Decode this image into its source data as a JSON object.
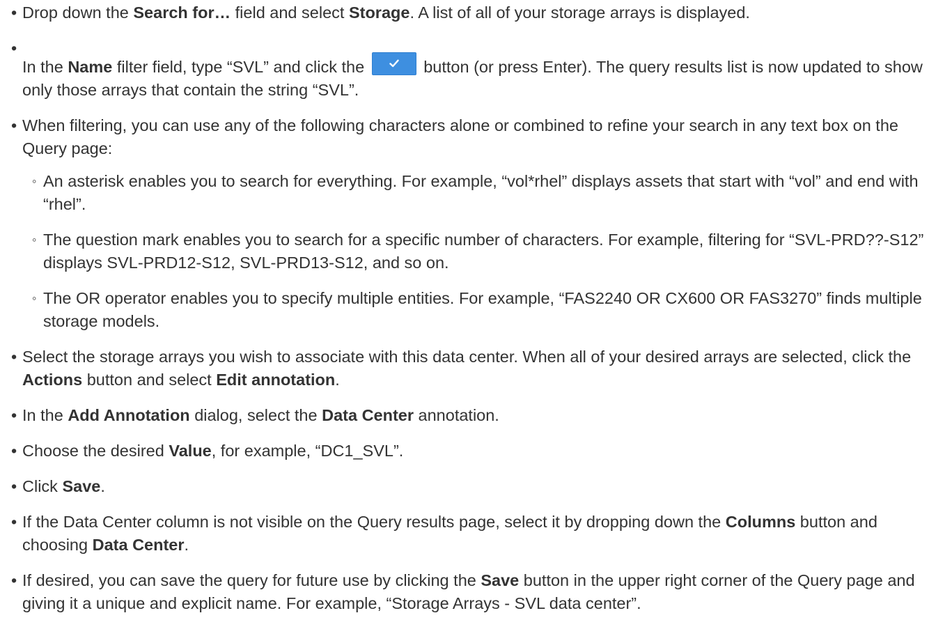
{
  "steps": [
    {
      "parts": [
        {
          "t": "Drop down the "
        },
        {
          "t": "Search for…",
          "b": true
        },
        {
          "t": " field and select "
        },
        {
          "t": "Storage",
          "b": true
        },
        {
          "t": ". A list of all of your storage arrays is displayed."
        }
      ]
    },
    {
      "parts_before": [
        {
          "t": "In the "
        },
        {
          "t": "Name",
          "b": true
        },
        {
          "t": " filter field, type “SVL” and click the "
        }
      ],
      "button_icon": "checkmark-icon",
      "parts_after": [
        {
          "t": " button (or press Enter). The query results list is now updated to show only those arrays that contain the string “SVL”."
        }
      ]
    },
    {
      "parts": [
        {
          "t": "When filtering, you can use any of the following characters alone or combined to refine your search in any text box on the Query page:"
        }
      ],
      "subitems": [
        "An asterisk enables you to search for everything. For example, “vol*rhel” displays assets that start with “vol” and end with “rhel”.",
        "The question mark enables you to search for a specific number of characters. For example, filtering for “SVL-PRD??-S12” displays SVL-PRD12-S12, SVL-PRD13-S12, and so on.",
        "The OR operator enables you to specify multiple entities. For example, “FAS2240 OR CX600 OR FAS3270” finds multiple storage models."
      ]
    },
    {
      "parts": [
        {
          "t": "Select the storage arrays you wish to associate with this data center. When all of your desired arrays are selected, click the "
        },
        {
          "t": "Actions",
          "b": true
        },
        {
          "t": " button and select "
        },
        {
          "t": "Edit annotation",
          "b": true
        },
        {
          "t": "."
        }
      ]
    },
    {
      "parts": [
        {
          "t": "In the "
        },
        {
          "t": "Add Annotation",
          "b": true
        },
        {
          "t": " dialog, select the "
        },
        {
          "t": "Data Center",
          "b": true
        },
        {
          "t": " annotation."
        }
      ]
    },
    {
      "parts": [
        {
          "t": "Choose the desired "
        },
        {
          "t": "Value",
          "b": true
        },
        {
          "t": ", for example, “DC1_SVL”."
        }
      ]
    },
    {
      "parts": [
        {
          "t": "Click "
        },
        {
          "t": "Save",
          "b": true
        },
        {
          "t": "."
        }
      ]
    },
    {
      "parts": [
        {
          "t": "If the Data Center column is not visible on the Query results page, select it by dropping down the "
        },
        {
          "t": "Columns",
          "b": true
        },
        {
          "t": " button and choosing "
        },
        {
          "t": "Data Center",
          "b": true
        },
        {
          "t": "."
        }
      ]
    },
    {
      "parts": [
        {
          "t": "If desired, you can save the query for future use by clicking the "
        },
        {
          "t": "Save",
          "b": true
        },
        {
          "t": " button in the upper right corner of the Query page and giving it a unique and explicit name. For example, “Storage Arrays - SVL data center”."
        }
      ]
    }
  ],
  "colors": {
    "text": "#333333",
    "button": "#3e8fe0"
  }
}
